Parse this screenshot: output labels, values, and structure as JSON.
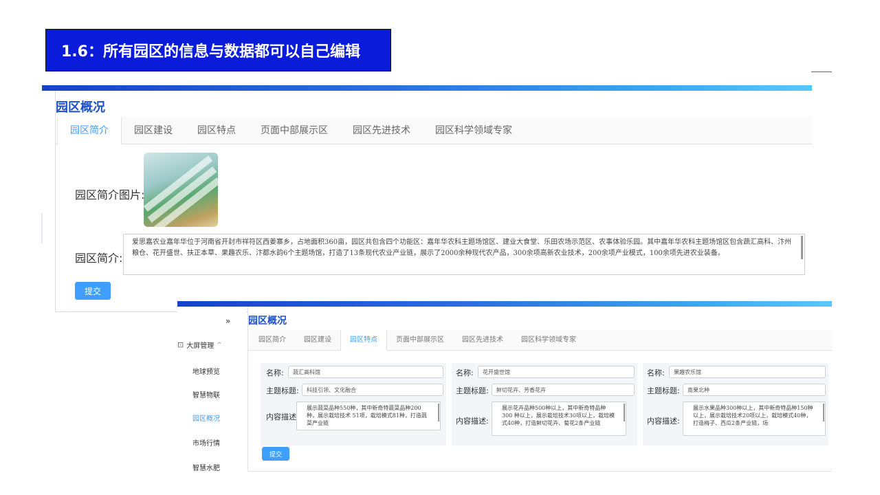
{
  "slide": {
    "title": "1.6：所有园区的信息与数据都可以自己编辑"
  },
  "panel1": {
    "section_title": "园区概况",
    "tabs": [
      "园区简介",
      "园区建设",
      "园区特点",
      "页面中部展示区",
      "园区先进技术",
      "园区科学领域专家"
    ],
    "active_tab": 0,
    "image_label": "园区简介图片:",
    "desc_label": "园区简介:",
    "desc_text": "爱思嘉农业嘉年华位于河南省开封市祥符区西姜寨乡，占地面积360亩，园区共包含四个功能区：嘉年华农科主题场馆区、建业大食堂、乐田农场示范区、农事体验乐园。其中嘉年华农科主题场馆区包含蔬汇高科、汴州粮仓、花开盛世、扶正本草、果趣农乐、汴都水韵6个主题场馆，打造了13条现代农业产业链，展示了2000余种现代农产品，300余项高新农业技术，200余项产业模式，100余项先进农业装备。",
    "submit_label": "提交"
  },
  "sidebar": {
    "collapse_icon_text": "»",
    "group_label": "大屏管理",
    "items": [
      "地球预览",
      "智慧物联",
      "园区概况",
      "市场行情",
      "智慧水肥"
    ],
    "active_item": 2
  },
  "panel2": {
    "section_title": "园区概况",
    "tabs": [
      "园区简介",
      "园区建设",
      "园区特点",
      "页面中部展示区",
      "园区先进技术",
      "园区科学领域专家"
    ],
    "active_tab": 2,
    "labels": {
      "name": "名称:",
      "theme": "主题标题:",
      "content": "内容描述:"
    },
    "cards": [
      {
        "name": "蔬汇高科馆",
        "theme": "科技引领、文化融合",
        "content": "展示蔬菜品种550种，其中新奇特蔬菜品种200种，展示栽培技术 51项，栽培模式81种，打造蔬菜产业链"
      },
      {
        "name": "花开盛世馆",
        "theme": "鲜切花卉、芳香花卉",
        "content": "展示花卉品种500种以上，其中新奇特品种300 种以上，展示栽培技术30项以上，栽培模式40种，打造鲜切花卉、菊花2条产业链"
      },
      {
        "name": "果趣农乐馆",
        "theme": "南果北种",
        "content": "展示水果品种300种以上，其中新奇特品种150种以上，展示栽培技术20项以上，栽培模式40种，打造梅子、西瓜2条产业链，场"
      }
    ],
    "submit_label": "提交"
  },
  "colors": {
    "banner": "#0a1bd9",
    "accent": "#409eff",
    "title_blue": "#1c4fc9"
  }
}
